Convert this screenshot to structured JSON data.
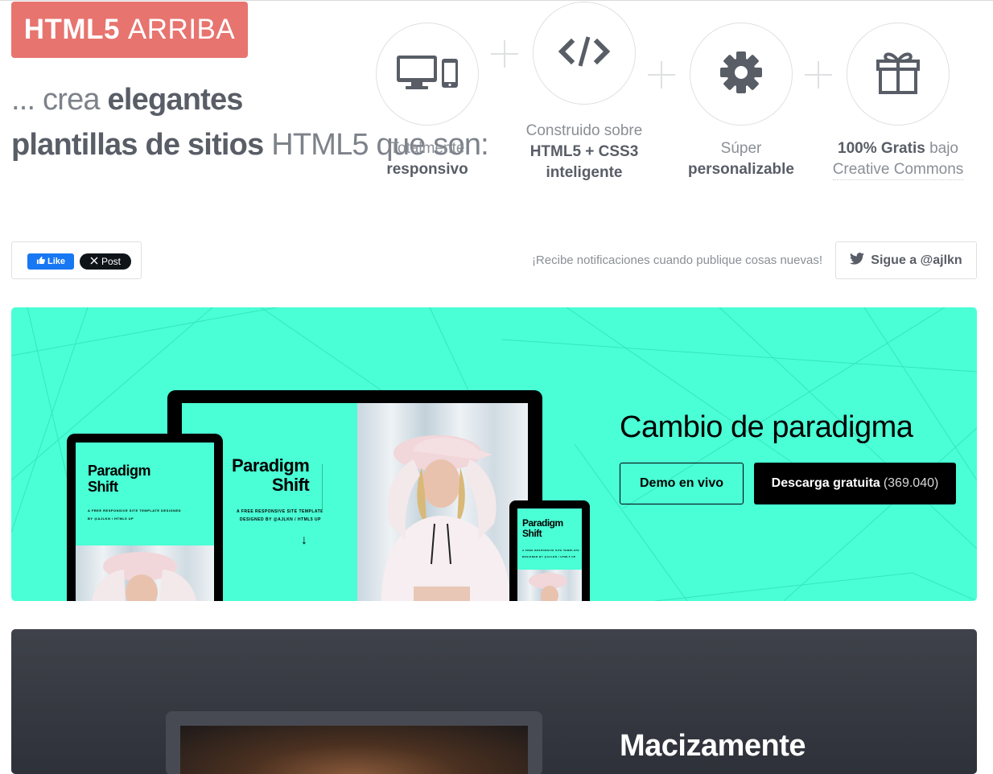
{
  "logo": {
    "bold": "HTML5",
    "light": "ARRIBA"
  },
  "headline": {
    "prefix": "... crea",
    "strong1": "elegantes",
    "strong2": "plantillas de sitios",
    "suffix": "HTML5 que son:"
  },
  "features": [
    {
      "icon": "devices-icon",
      "line1": "Totalmente",
      "line2": "responsivo"
    },
    {
      "icon": "code-icon",
      "line1": "Construido sobre",
      "line2": "HTML5 + CSS3",
      "line3": "inteligente"
    },
    {
      "icon": "gear-icon",
      "line1": "Súper",
      "line2": "personalizable"
    },
    {
      "icon": "gift-icon",
      "strong": "100% Gratis",
      "rest": "bajo",
      "line2": "Creative Commons"
    }
  ],
  "social": {
    "fb_like": "Like",
    "x_post": "Post",
    "notify": "¡Recibe notificaciones cuando publique cosas nuevas!",
    "follow": "Sigue a @ajlkn"
  },
  "showcase1": {
    "title": "Cambio de paradigma",
    "demo_label": "Demo en vivo",
    "download_label": "Descarga gratuita",
    "download_count": "(369.040)",
    "accent": "#4affd5",
    "mock": {
      "title1": "Paradigm",
      "title2": "Shift",
      "sub1": "A FREE RESPONSIVE SITE TEMPLATE DESIGNED",
      "sub2": "BY @AJLKN / HTML5 UP",
      "sub_laptop1": "A FREE RESPONSIVE SITE TEMPLATE",
      "sub_laptop2": "DESIGNED BY @AJLKN / HTML5 UP"
    }
  },
  "showcase2": {
    "title": "Macizamente"
  }
}
